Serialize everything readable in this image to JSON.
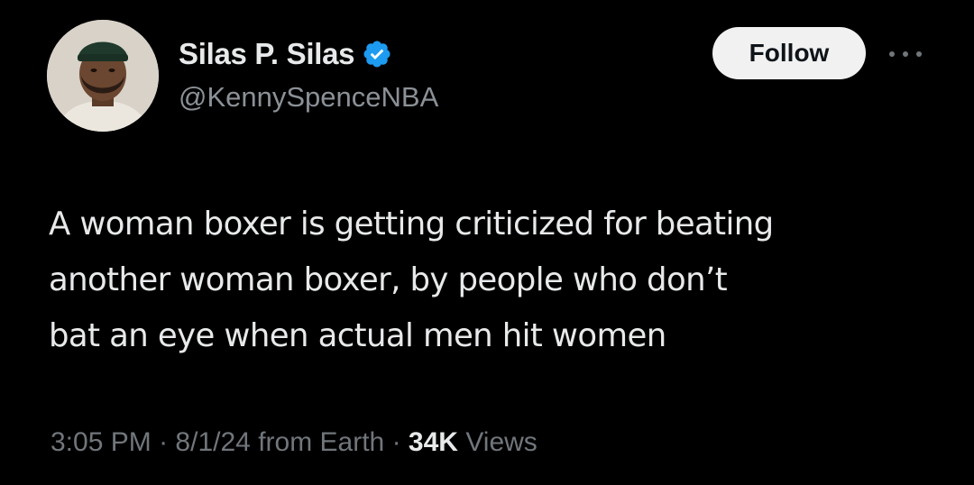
{
  "author": {
    "display_name": "Silas P. Silas",
    "handle": "@KennySpenceNBA",
    "verified": true
  },
  "actions": {
    "follow_label": "Follow",
    "more_icon": "more-horizontal-icon"
  },
  "tweet": {
    "lines": [
      "A woman boxer is getting criticized for beating",
      "another woman boxer, by people who don’t",
      "bat an eye when actual men hit women"
    ]
  },
  "meta": {
    "time": "3:05 PM",
    "separator": "·",
    "date": "8/1/24",
    "source": "from Earth",
    "views_count": "34K",
    "views_label": "Views"
  },
  "colors": {
    "background": "#000000",
    "text": "#e7e9ea",
    "secondary": "#71767b",
    "verified_blue": "#1d9bf0",
    "follow_bg": "#f1f1f1"
  }
}
